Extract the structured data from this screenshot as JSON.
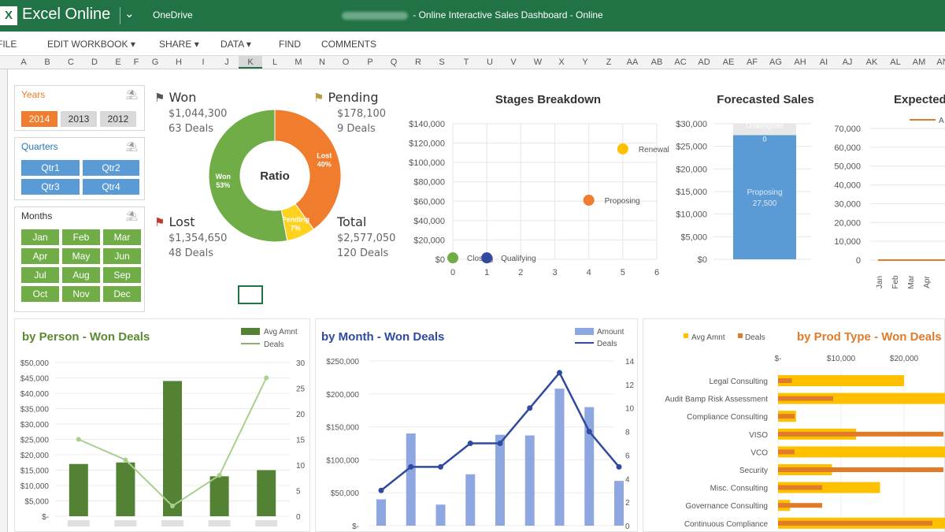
{
  "titlebar": {
    "app": "Excel Online",
    "location": "OneDrive",
    "doc_title": "- Online Interactive Sales Dashboard - Online",
    "logo": "X"
  },
  "menu": [
    "FILE",
    "EDIT WORKBOOK",
    "SHARE",
    "DATA",
    "FIND",
    "COMMENTS"
  ],
  "columns": [
    "A",
    "B",
    "C",
    "D",
    "E",
    "F",
    "G",
    "H",
    "I",
    "J",
    "K",
    "L",
    "M",
    "N",
    "O",
    "P",
    "Q",
    "R",
    "S",
    "T",
    "U",
    "V",
    "W",
    "X",
    "Y",
    "Z",
    "AA",
    "AB",
    "AC",
    "AD",
    "AE",
    "AF",
    "AG",
    "AH",
    "AI",
    "AJ",
    "AK",
    "AL",
    "AM",
    "AN"
  ],
  "selected_column": "K",
  "colors": {
    "green": "#217346",
    "orange": "#f07c2e",
    "olive": "#70ad47",
    "blue": "#5b9bd5",
    "yellow": "#ffc000",
    "bars": "#8fa7e0",
    "line": "#2f4a9e"
  },
  "slicers": {
    "years": {
      "title": "Years",
      "items": [
        "2014",
        "2013",
        "2012"
      ],
      "selected": "2014"
    },
    "quarters": {
      "title": "Quarters",
      "items": [
        "Qtr1",
        "Qtr2",
        "Qtr3",
        "Qtr4"
      ]
    },
    "months": {
      "title": "Months",
      "items": [
        "Jan",
        "Feb",
        "Mar",
        "Apr",
        "May",
        "Jun",
        "Jul",
        "Aug",
        "Sep",
        "Oct",
        "Nov",
        "Dec"
      ]
    }
  },
  "kpi": {
    "won": {
      "label": "Won",
      "amount": "$1,044,300",
      "deals": "63 Deals"
    },
    "pending": {
      "label": "Pending",
      "amount": "$178,100",
      "deals": "9 Deals"
    },
    "lost": {
      "label": "Lost",
      "amount": "$1,354,650",
      "deals": "48 Deals"
    },
    "total": {
      "label": "Total",
      "amount": "$2,577,050",
      "deals": "120 Deals"
    }
  },
  "chart_data": [
    {
      "type": "pie",
      "title": "Ratio",
      "labels": [
        "Won",
        "Lost",
        "Pending"
      ],
      "data_labels": [
        "53%",
        "40%",
        "7%"
      ],
      "values": [
        53,
        40,
        7
      ]
    },
    {
      "type": "scatter",
      "title": "Stages Breakdown",
      "xlim": [
        0,
        6
      ],
      "ylim": [
        0,
        140000
      ],
      "xticks": [
        "0",
        "1",
        "2",
        "3",
        "4",
        "5",
        "6"
      ],
      "yticks": [
        "$0",
        "$20,000",
        "$40,000",
        "$60,000",
        "$80,000",
        "$100,000",
        "$120,000",
        "$140,000"
      ],
      "points": [
        {
          "label": "Closing",
          "x": 0,
          "y": 1500
        },
        {
          "label": "Qualifying",
          "x": 1,
          "y": 1500
        },
        {
          "label": "Proposing",
          "x": 4,
          "y": 61000
        },
        {
          "label": "Renewal",
          "x": 5,
          "y": 114000
        }
      ]
    },
    {
      "type": "bar",
      "title": "Forecasted Sales",
      "ylim": [
        0,
        30000
      ],
      "yticks": [
        "$0",
        "$5,000",
        "$10,000",
        "$15,000",
        "$20,000",
        "$25,000",
        "$30,000"
      ],
      "series": [
        {
          "name": "Proposing",
          "values": [
            27500
          ],
          "data_label": "27,500"
        },
        {
          "name": "Unassigned",
          "values": [
            0
          ],
          "data_label": "0"
        }
      ]
    },
    {
      "type": "line",
      "title": "Expected",
      "ylim": [
        0,
        70000
      ],
      "yticks": [
        "0",
        "10,000",
        "20,000",
        "30,000",
        "40,000",
        "50,000",
        "60,000",
        "70,000"
      ],
      "categories": [
        "Jan",
        "Feb",
        "Mar",
        "Apr"
      ],
      "legend": "A"
    },
    {
      "type": "bar",
      "title": "by Person - Won Deals",
      "ylim": [
        0,
        50000
      ],
      "y2lim": [
        0,
        30
      ],
      "yticks": [
        "$-",
        "$5,000",
        "$10,000",
        "$15,000",
        "$20,000",
        "$25,000",
        "$30,000",
        "$35,000",
        "$40,000",
        "$45,000",
        "$50,000"
      ],
      "y2ticks": [
        "0",
        "5",
        "10",
        "15",
        "20",
        "25",
        "30"
      ],
      "series": [
        {
          "name": "Avg Amnt",
          "values": [
            17000,
            17500,
            44000,
            13000,
            15000
          ]
        },
        {
          "name": "Deals",
          "values": [
            15,
            11,
            2,
            8,
            27
          ]
        }
      ]
    },
    {
      "type": "bar",
      "title": "by Month - Won Deals",
      "ylim": [
        0,
        250000
      ],
      "y2lim": [
        0,
        14
      ],
      "yticks": [
        "$-",
        "$50,000",
        "$100,000",
        "$150,000",
        "$200,000",
        "$250,000"
      ],
      "y2ticks": [
        "0",
        "2",
        "4",
        "6",
        "8",
        "10",
        "12",
        "14"
      ],
      "series": [
        {
          "name": "Amount",
          "values": [
            40000,
            140000,
            32000,
            78000,
            138000,
            137000,
            208000,
            180000,
            68000
          ]
        },
        {
          "name": "Deals",
          "values": [
            3,
            5,
            5,
            7,
            7,
            10,
            13,
            8,
            5
          ]
        }
      ]
    },
    {
      "type": "bar",
      "title": "by Prod Type - Won Deals",
      "xticks": [
        "$-",
        "$10,000",
        "$20,000"
      ],
      "categories": [
        "Legal Consulting",
        "Audit Bamp Risk Assessment",
        "Compliance Consulting",
        "VISO",
        "VCO",
        "Security",
        "Misc. Consulting",
        "Governance Consulting",
        "Continuous Compliance"
      ],
      "series": [
        {
          "name": "Avg Amnt",
          "values": [
            21000,
            30000,
            3000,
            13000,
            30000,
            9000,
            17000,
            2000,
            30000
          ]
        },
        {
          "name": "Deals",
          "values": [
            2.5,
            10,
            3,
            30,
            3,
            30,
            8,
            8,
            28
          ]
        }
      ]
    }
  ]
}
